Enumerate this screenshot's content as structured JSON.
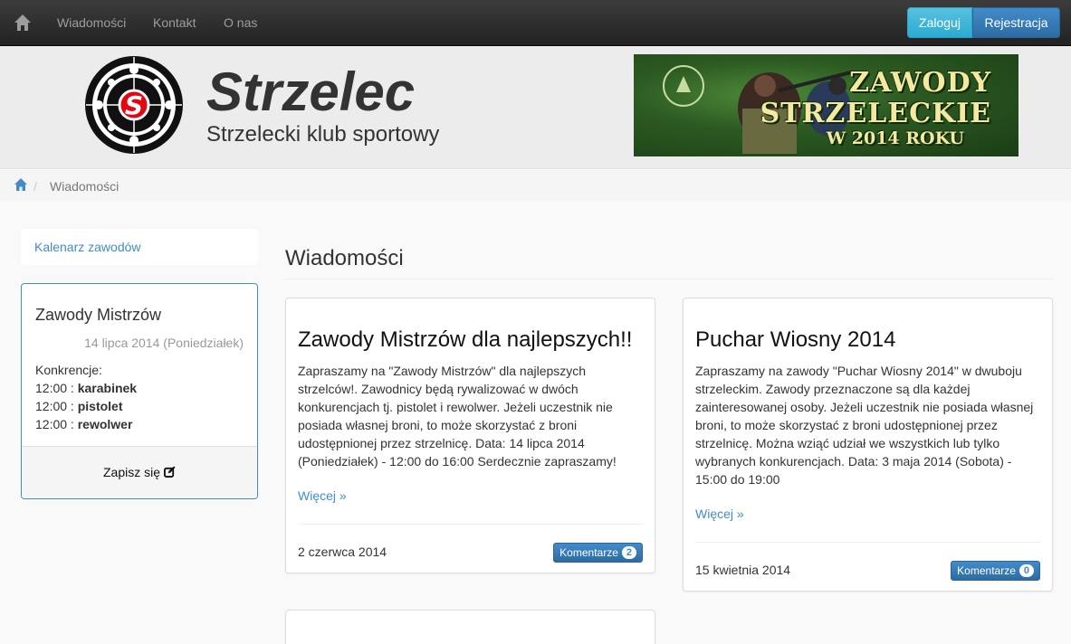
{
  "navbar": {
    "links": [
      "Wiadomości",
      "Kontakt",
      "O nas"
    ],
    "login_label": "Zaloguj",
    "register_label": "Rejestracja"
  },
  "header": {
    "title": "Strzelec",
    "subtitle": "Strzelecki klub sportowy",
    "logo_letter": "S",
    "banner": {
      "line1": "ZAWODY",
      "line2": "STRZELECKIE",
      "line3": "W 2014 ROKU"
    }
  },
  "breadcrumb": {
    "separator": "/",
    "current": "Wiadomości"
  },
  "sidebar": {
    "calendar_link": "Kalenarz zawodów",
    "event": {
      "title": "Zawody Mistrzów",
      "date": "14 lipca 2014 (Poniedziałek)",
      "competitions_label": "Konkrencje:",
      "competitions": [
        {
          "time": "12:00",
          "name": "karabinek"
        },
        {
          "time": "12:00",
          "name": "pistolet"
        },
        {
          "time": "12:00",
          "name": "rewolwer"
        }
      ],
      "signup_label": "Zapisz się"
    }
  },
  "main": {
    "title": "Wiadomości",
    "posts": [
      {
        "title": "Zawody Mistrzów dla najlepszych!!",
        "body": "Zapraszamy na \"Zawody Mistrzów\" dla najlepszych strzelców!. Zawodnicy będą rywalizować w dwóch konkurencjach tj. pistolet i rewolwer. Jeżeli uczestnik nie posiada własnej broni, to może skorzystać z broni udostępnionej przez strzelnicę. Data: 14 lipca 2014 (Poniedziałek) - 12:00 do 16:00 Serdecznie zapraszamy!",
        "more": "Więcej »",
        "date": "2 czerwca 2014",
        "comments_label": "Komentarze",
        "comments_count": "2"
      },
      {
        "title": "Puchar Wiosny 2014",
        "body": "Zapraszamy na zawody \"Puchar Wiosny 2014\" w dwuboju strzeleckim. Zawody przeznaczone są dla każdej zainteresowanej osoby. Jeżeli uczestnik nie posiada własnej broni, to może skorzystać z broni udostępnionej przez strzelnicę. Można wziąć udział we wszystkich lub tylko wybranych konkurencjach. Data: 3 maja 2014 (Sobota) - 15:00 do 19:00",
        "more": "Więcej »",
        "date": "15 kwietnia 2014",
        "comments_label": "Komentarze",
        "comments_count": "0"
      }
    ]
  },
  "colors": {
    "accent": "#428bca",
    "login": "#5bc0de",
    "navbar": "#222222",
    "header_bg": "#ececec"
  },
  "icons": [
    "home-icon",
    "edit-icon",
    "target-logo"
  ]
}
